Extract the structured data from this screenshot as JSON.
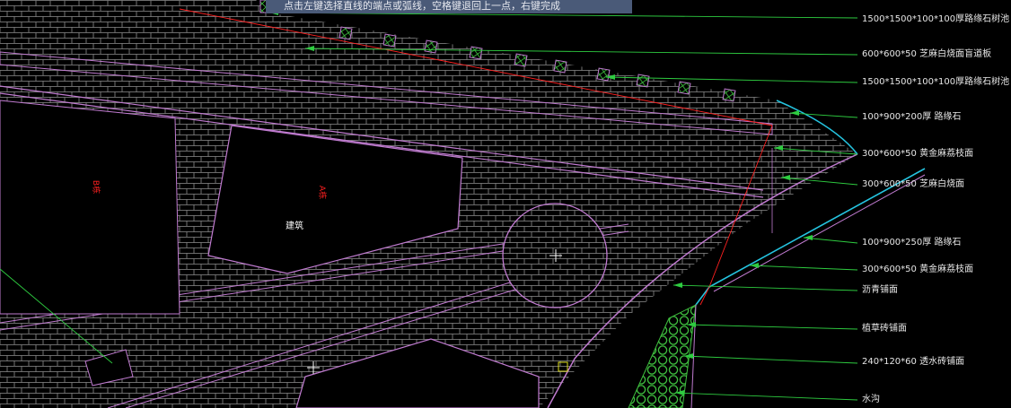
{
  "prompt": {
    "text": "点击左键选择直线的端点或弧线，空格键退回上一点，右键完成"
  },
  "annotations": [
    "1500*1500*100*100厚路缘石树池",
    "600*600*50 芝麻白烧面盲道板",
    "1500*1500*100*100厚路缘石树池",
    "100*900*200厚 路缘石",
    "300*600*50 黄金麻荔枝面",
    "300*600*50 芝麻白烧面",
    "100*900*250厚 路缘石",
    "300*600*50 黄金麻荔枝面",
    "沥青铺面",
    "植草砖铺面",
    "240*120*60 透水砖铺面",
    "水沟"
  ],
  "building_labels": {
    "b_block": "B栋",
    "a_block": "A栋",
    "building_text": "建筑"
  },
  "colors": {
    "background": "#000000",
    "paving_lines": "#9a9a9a",
    "outline": "#c07bd0",
    "leader": "#2ecc40",
    "curb": "#25c4e0",
    "red_line": "#ff2020",
    "prompt_bg": "#4a5a78"
  }
}
